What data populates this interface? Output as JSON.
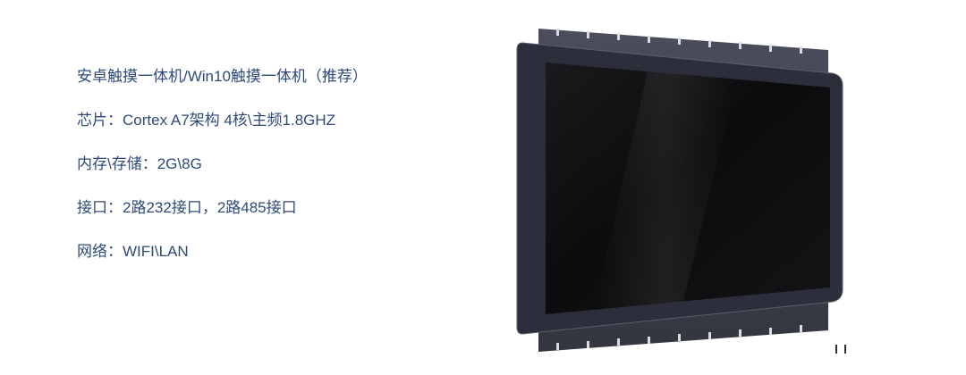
{
  "specs": {
    "lines": [
      "安卓触摸一体机/Win10触摸一体机（推荐）",
      "芯片：Cortex A7架构  4核\\主频1.8GHZ",
      "内存\\存储：2G\\8G",
      "接口：2路232接口，2路485接口",
      "网络：WIFI\\LAN"
    ]
  },
  "product": {
    "image": "open-frame-touch-display-photo",
    "colors": {
      "bezel": "#2c2f3b",
      "screen": "#0e0e10",
      "mount_plate": "#3e4250"
    }
  }
}
